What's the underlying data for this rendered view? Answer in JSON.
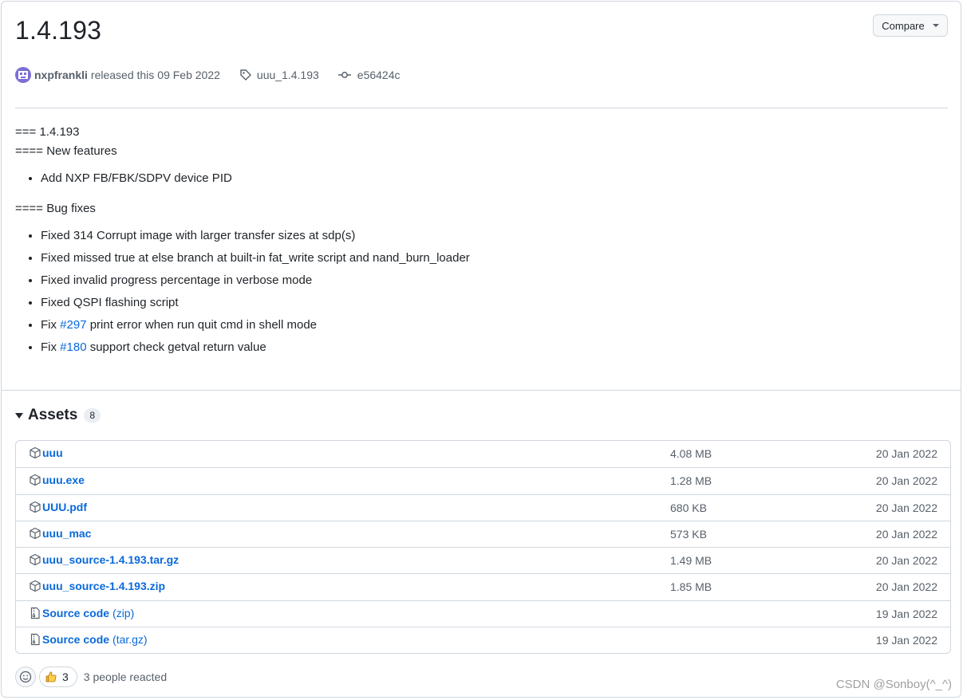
{
  "release": {
    "title": "1.4.193",
    "compare_label": "Compare",
    "author": "nxpfrankli",
    "released_text": "released this",
    "released_date": "09 Feb 2022",
    "tag": "uuu_1.4.193",
    "commit": "e56424c"
  },
  "notes": {
    "heading1": "=== 1.4.193",
    "heading2": "==== New features",
    "features": [
      "Add NXP FB/FBK/SDPV device PID"
    ],
    "heading3": "==== Bug fixes",
    "bugfixes": [
      "Fixed 314 Corrupt image with larger transfer sizes at sdp(s)",
      "Fixed missed true at else branch at built-in fat_write script and nand_burn_loader",
      "Fixed invalid progress percentage in verbose mode",
      "Fixed QSPI flashing script"
    ],
    "fix_issue1": {
      "prefix": "Fix",
      "link": "#297",
      "suffix": "print error when run quit cmd in shell mode"
    },
    "fix_issue2": {
      "prefix": "Fix",
      "link": "#180",
      "suffix": "support check getval return value"
    }
  },
  "assets": {
    "label": "Assets",
    "count": "8",
    "items": [
      {
        "name": "uuu",
        "size": "4.08 MB",
        "date": "20 Jan 2022",
        "icon": "package-icon"
      },
      {
        "name": "uuu.exe",
        "size": "1.28 MB",
        "date": "20 Jan 2022",
        "icon": "package-icon"
      },
      {
        "name": "UUU.pdf",
        "size": "680 KB",
        "date": "20 Jan 2022",
        "icon": "package-icon"
      },
      {
        "name": "uuu_mac",
        "size": "573 KB",
        "date": "20 Jan 2022",
        "icon": "package-icon"
      },
      {
        "name": "uuu_source-1.4.193.tar.gz",
        "size": "1.49 MB",
        "date": "20 Jan 2022",
        "icon": "package-icon"
      },
      {
        "name": "uuu_source-1.4.193.zip",
        "size": "1.85 MB",
        "date": "20 Jan 2022",
        "icon": "package-icon"
      },
      {
        "name": "Source code",
        "suffix": "(zip)",
        "size": "",
        "date": "19 Jan 2022",
        "icon": "file-zip-icon"
      },
      {
        "name": "Source code",
        "suffix": "(tar.gz)",
        "size": "",
        "date": "19 Jan 2022",
        "icon": "file-zip-icon"
      }
    ]
  },
  "reactions": {
    "thumbs_count": "3",
    "summary": "3 people reacted"
  },
  "watermark": "CSDN @Sonboy(^_^)",
  "colors": {
    "link": "#0969da",
    "border": "#d0d7de",
    "muted": "#57606a"
  }
}
